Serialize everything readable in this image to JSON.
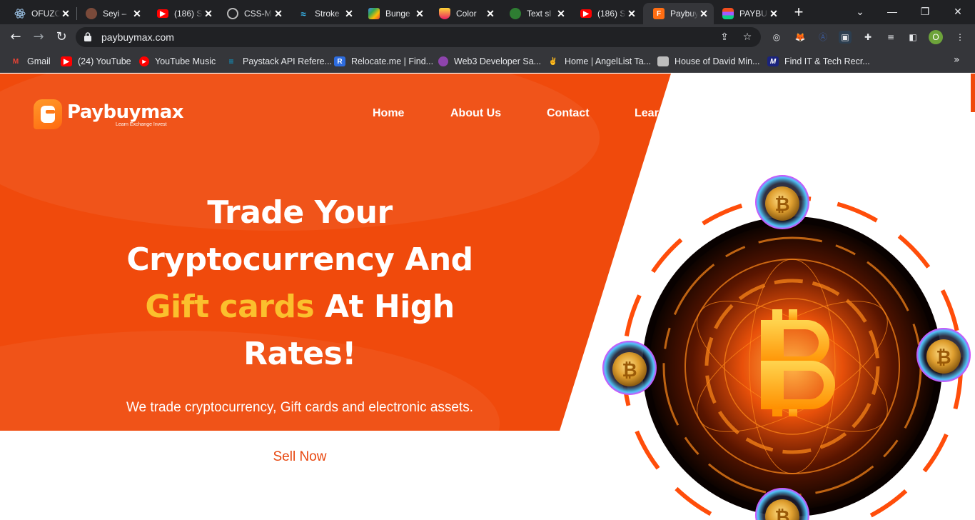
{
  "browser": {
    "tabs": [
      {
        "label": "OFUZO",
        "icon": "react-icon",
        "active": false
      },
      {
        "label": "Seyi –",
        "icon": "avatar-icon",
        "active": false
      },
      {
        "label": "(186) S",
        "icon": "youtube-icon",
        "active": false
      },
      {
        "label": "CSS-M",
        "icon": "github-icon",
        "active": false
      },
      {
        "label": "Stroke",
        "icon": "tailwind-icon",
        "active": false
      },
      {
        "label": "Bunge",
        "icon": "bungee-icon",
        "active": false
      },
      {
        "label": "Color",
        "icon": "color-icon",
        "active": false
      },
      {
        "label": "Text sl",
        "icon": "robot-icon",
        "active": false
      },
      {
        "label": "(186) S",
        "icon": "youtube-icon",
        "active": false
      },
      {
        "label": "Paybuy",
        "icon": "paybuymax-icon",
        "active": true
      },
      {
        "label": "PAYBU",
        "icon": "figma-icon",
        "active": false
      }
    ],
    "url": "paybuymax.com",
    "profile_initial": "O",
    "bookmarks": [
      {
        "label": "Gmail",
        "icon": "gmail-icon",
        "color": "#ea4335"
      },
      {
        "label": "(24) YouTube",
        "icon": "youtube-icon",
        "color": "#ff0000"
      },
      {
        "label": "YouTube Music",
        "icon": "youtube-music-icon",
        "color": "#ff0000"
      },
      {
        "label": "Paystack API Refere...",
        "icon": "paystack-icon",
        "color": "#09a5db"
      },
      {
        "label": "Relocate.me | Find...",
        "icon": "relocate-icon",
        "color": "#2d6cdf"
      },
      {
        "label": "Web3 Developer Sa...",
        "icon": "web3-icon",
        "color": "#8e44ad"
      },
      {
        "label": "Home | AngelList Ta...",
        "icon": "angellist-icon",
        "color": "#ffffff"
      },
      {
        "label": "House of David Min...",
        "icon": "house-icon",
        "color": "#cccccc"
      },
      {
        "label": "Find IT & Tech Recr...",
        "icon": "m-icon",
        "color": "#1a237e"
      }
    ]
  },
  "site": {
    "brand": "Paybuymax",
    "tagline": "Learn  Exchange  Invest",
    "nav": [
      "Home",
      "About Us",
      "Contact",
      "Learn"
    ],
    "headline_line1": "Trade Your",
    "headline_line2": "Cryptocurrency And",
    "headline_highlight": "Gift cards",
    "headline_line3_rest": " At High",
    "headline_line4": "Rates!",
    "subhead": "We trade cryptocurrency, Gift cards and electronic assets.",
    "cta": "Sell Now",
    "colors": {
      "primary": "#f04a0c",
      "highlight": "#fbc02d",
      "cta_text": "#e8470f"
    }
  }
}
